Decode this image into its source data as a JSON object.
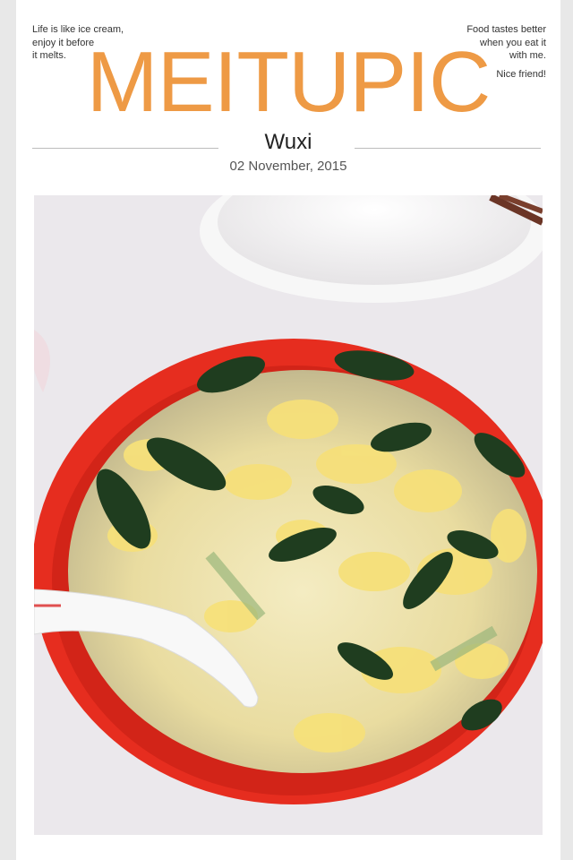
{
  "quotes": {
    "left": [
      "Life is like ice cream,",
      "enjoy it before",
      "it melts."
    ],
    "right": [
      "Food tastes better",
      "when you eat it",
      "with me."
    ],
    "right_extra": "Nice friend!"
  },
  "brand": "MEITUPIC",
  "location": "Wuxi",
  "date": "02 November, 2015",
  "colors": {
    "brand": "#ee9a45",
    "bowl": "#e62d1f"
  },
  "photo": {
    "subject": "egg-spinach-soup-bowl-photo"
  }
}
